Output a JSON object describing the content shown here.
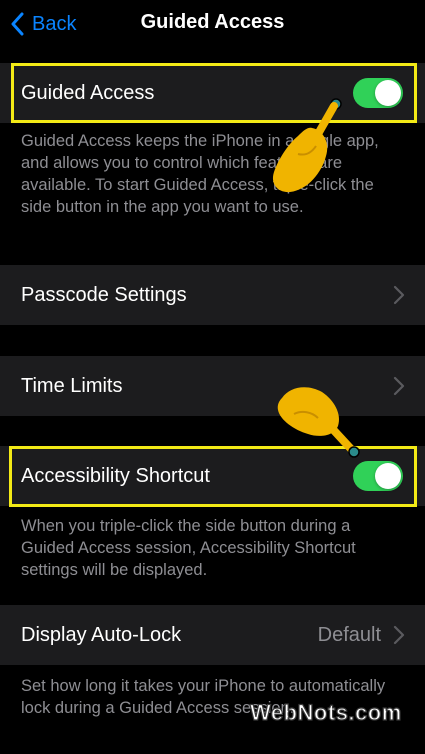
{
  "nav": {
    "back_label": "Back",
    "title": "Guided Access"
  },
  "guided_access": {
    "label": "Guided Access",
    "enabled": true,
    "description": "Guided Access keeps the iPhone in a single app, and allows you to control which features are available. To start Guided Access, triple-click the side button in the app you want to use."
  },
  "passcode_settings": {
    "label": "Passcode Settings"
  },
  "time_limits": {
    "label": "Time Limits"
  },
  "accessibility_shortcut": {
    "label": "Accessibility Shortcut",
    "enabled": true,
    "description": "When you triple-click the side button during a Guided Access session, Accessibility Shortcut settings will be displayed."
  },
  "display_auto_lock": {
    "label": "Display Auto-Lock",
    "value": "Default",
    "description": "Set how long it takes your iPhone to automatically lock during a Guided Access session."
  },
  "watermark": "WebNots.com",
  "colors": {
    "accent": "#0a84ff",
    "toggle_on": "#30d158",
    "highlight": "#f3ea16",
    "pointer": "#f0b400"
  }
}
